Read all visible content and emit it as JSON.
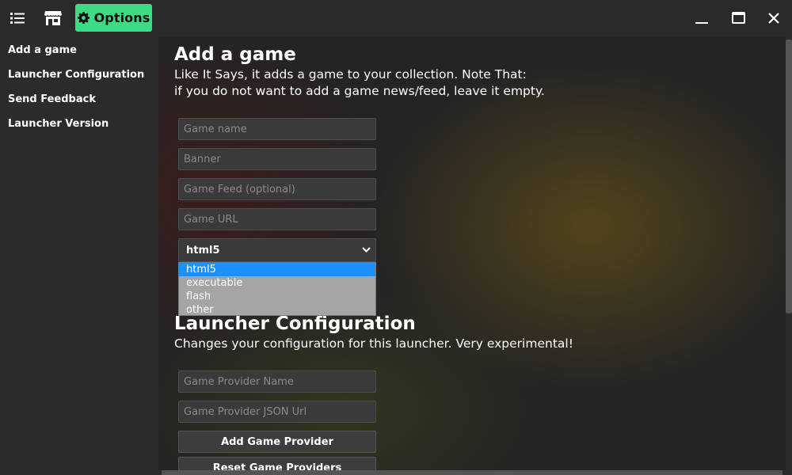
{
  "titlebar": {
    "options_label": "Options",
    "accent_color": "#3ddc84"
  },
  "sidebar": {
    "items": [
      {
        "label": "Add a game"
      },
      {
        "label": "Launcher Configuration"
      },
      {
        "label": "Send Feedback"
      },
      {
        "label": "Launcher Version"
      }
    ]
  },
  "add_game": {
    "title": "Add a game",
    "desc_line1": "Like It Says, it adds a game to your collection. Note That:",
    "desc_line2": "if you do not want to add a game news/feed, leave it empty.",
    "name_placeholder": "Game name",
    "banner_placeholder": "Banner",
    "feed_placeholder": "Game Feed (optional)",
    "url_placeholder": "Game URL",
    "type_selected": "html5",
    "type_options": [
      "html5",
      "executable",
      "flash",
      "other"
    ]
  },
  "launcher_config": {
    "title": "Launcher Configuration",
    "desc": "Changes your configuration for this launcher. Very experimental!",
    "provider_name_placeholder": "Game Provider Name",
    "provider_url_placeholder": "Game Provider JSON Url",
    "add_provider_label": "Add Game Provider",
    "reset_providers_label": "Reset Game Providers"
  },
  "icons": {
    "list": "list-icon",
    "store": "store-icon",
    "gear": "gear-icon",
    "minimize": "minimize-icon",
    "maximize": "maximize-icon",
    "close": "close-icon"
  }
}
